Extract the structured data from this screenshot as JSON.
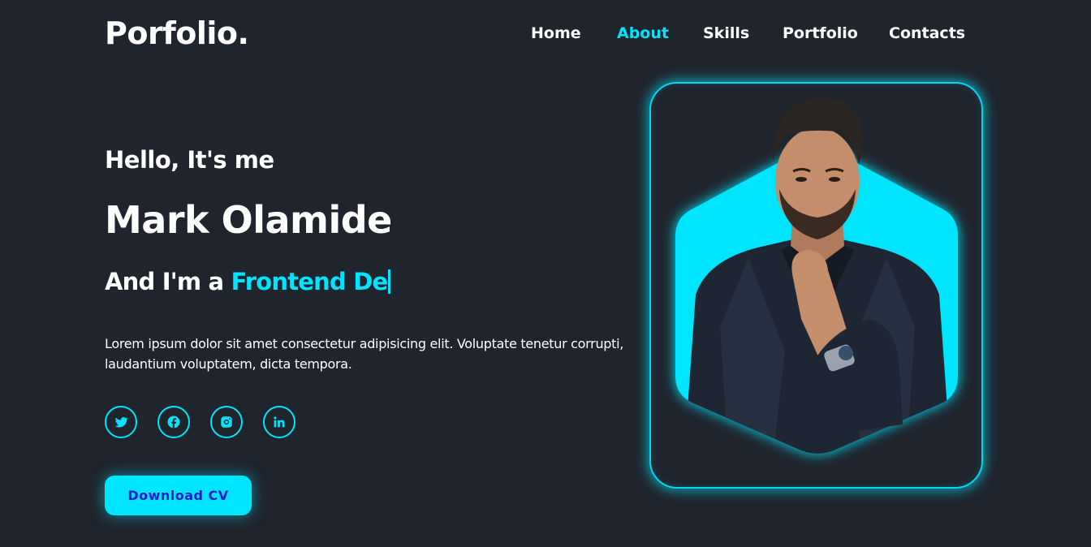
{
  "header": {
    "logo": "Porfolio.",
    "nav": [
      {
        "label": "Home",
        "active": false
      },
      {
        "label": "About",
        "active": true
      },
      {
        "label": "Skills",
        "active": false
      },
      {
        "label": "Portfolio",
        "active": false
      },
      {
        "label": "Contacts",
        "active": false
      }
    ]
  },
  "hero": {
    "greeting": "Hello, It's me",
    "name": "Mark Olamide",
    "role_prefix": "And I'm a ",
    "role_typed": "Frontend De",
    "description": "Lorem ipsum dolor sit amet consectetur adipisicing elit. Voluptate tenetur corrupti, laudantium voluptatem, dicta tempora.",
    "socials": [
      {
        "icon": "twitter-icon"
      },
      {
        "icon": "facebook-icon"
      },
      {
        "icon": "instagram-icon"
      },
      {
        "icon": "linkedin-icon"
      }
    ],
    "button_label": "Download CV"
  },
  "image": {
    "subject": "portrait-photo"
  },
  "colors": {
    "background": "#1f242d",
    "accent": "#00e5ff",
    "text": "#ffffff",
    "button_text": "#1a1acc"
  }
}
